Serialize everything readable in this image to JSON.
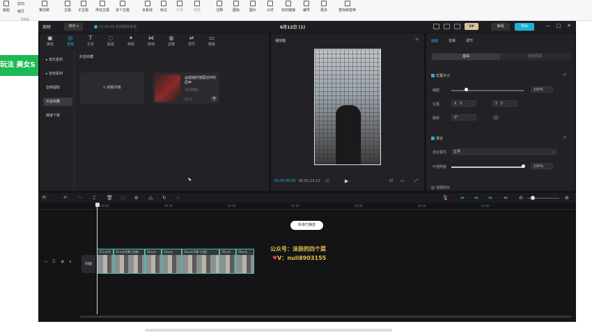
{
  "ribbon": {
    "paste": "粘贴",
    "cut": "剪切",
    "copy": "拷贝",
    "format_painter": "格式刷",
    "topic": "主题",
    "subtopic": "子主题",
    "float_topic": "浮动主题",
    "multi_topic": "多个主题",
    "relation": "关系线",
    "label": "标注",
    "outline": "外框",
    "summary": "概要",
    "comment": "注释",
    "icon": "图标",
    "image": "图片",
    "formula": "公式",
    "bilink": "双向链接",
    "number": "编号",
    "more": "更多",
    "find_replace": "查找和替换",
    "group_clipboard": "剪贴板"
  },
  "left_banner": "玩法 美女S",
  "app": {
    "logo": "剪映",
    "menu": "菜单 ▾",
    "autosave": "23:40:59 自动保存本地",
    "project_title": "6月12日 (1)",
    "vip": "VIP",
    "review": "审阅",
    "export": "导出"
  },
  "tools": [
    "媒体",
    "音频",
    "文本",
    "贴纸",
    "特效",
    "转场",
    "滤镜",
    "调节",
    "模板"
  ],
  "tool_glyphs": [
    "▣",
    "◎",
    "T",
    "◌",
    "✦",
    "⋈",
    "◍",
    "⇌",
    "▭"
  ],
  "audio_sidebar": [
    "音乐素材",
    "音效素材",
    "音频提取",
    "抖音收藏",
    "链接下载"
  ],
  "audio_section_title": "抖音收藏",
  "playlist_label": "刷新列表",
  "track_card": {
    "title": "@孤独的落尾创作的原声",
    "subtitle": "添加到播放",
    "duration": "00:13"
  },
  "player": {
    "title": "播放器",
    "current_time": "00:00:00:00",
    "total_time": "00:01:13:12"
  },
  "inspector": {
    "tabs": [
      "画面",
      "音频",
      "调节"
    ],
    "subtabs": [
      "基础",
      "抠像抠图"
    ],
    "section_position": "位置大小",
    "scale_label": "缩放",
    "scale_value": "100%",
    "position_label": "位置",
    "x_label": "X",
    "x_value": "0",
    "y_label": "Y",
    "y_value": "0",
    "rotate_label": "旋转",
    "rotate_value": "0°",
    "section_blend": "混合",
    "blend_mode_label": "混合模式",
    "blend_mode_value": "正常",
    "opacity_label": "不透明度",
    "opacity_value": "100%",
    "section_stabilize": "视频防抖"
  },
  "timeline": {
    "ticks": [
      "00:00",
      "00:30",
      "01:00",
      "01:30",
      "02:00",
      "02:30",
      "03:00"
    ],
    "chip": "轨道已静音",
    "cover": "封面",
    "clips": [
      "37公众号",
      "31公众号黄 (大屏)",
      "32公众",
      "33公众",
      "34公众号黄 (大屏)",
      "35公众",
      "36公众"
    ],
    "watermark1": "公众号：沫辰的四个菜",
    "watermark2": "V：nuli8903155"
  },
  "colors": {
    "accent": "#1db3d6",
    "banner_green": "#1db954",
    "clip_border": "#5ab4a8",
    "watermark": "#e3c34a"
  }
}
